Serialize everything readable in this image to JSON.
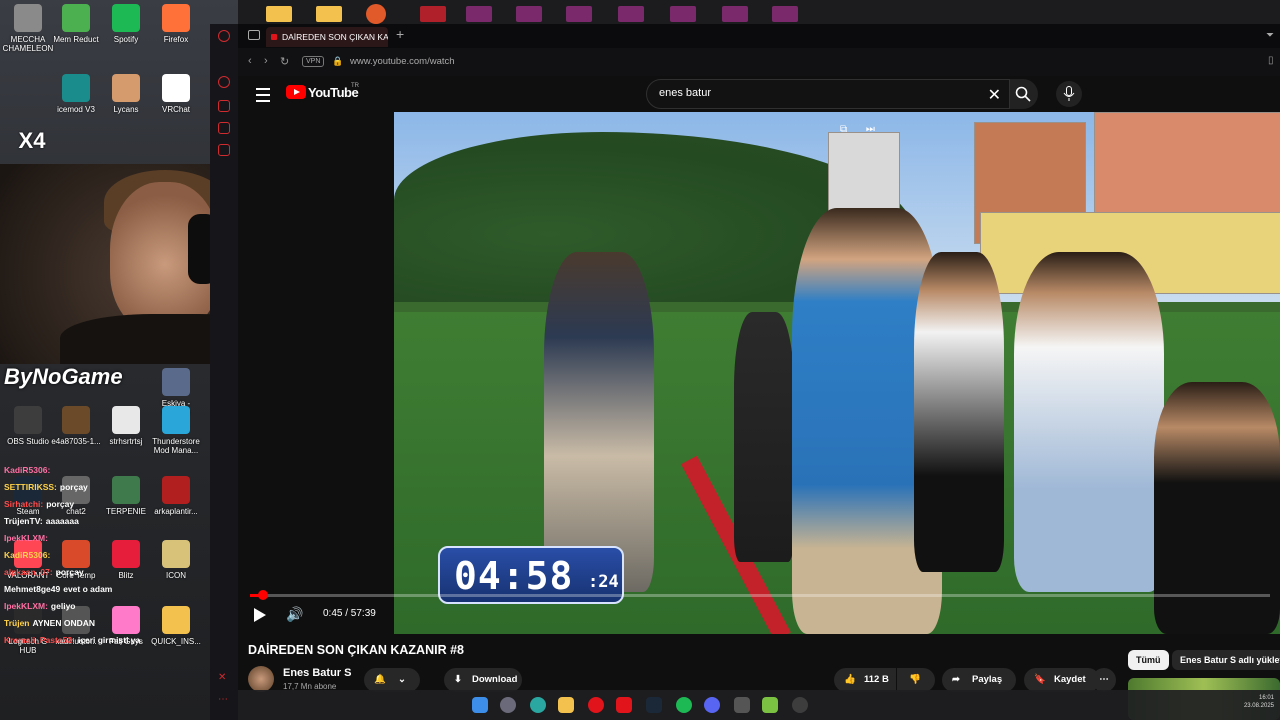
{
  "desktop": {
    "icons": [
      {
        "label": "MECCHA CHAMELEON",
        "color": "#8a8a8a"
      },
      {
        "label": "Mem Reduct",
        "color": "#4caf50"
      },
      {
        "label": "Spotify",
        "color": "#1db954"
      },
      {
        "label": "Firefox",
        "color": "#ff7139"
      },
      {
        "label": "icemod V3",
        "color": "#1b8c8c"
      },
      {
        "label": "Lycans",
        "color": "#d59b6d"
      },
      {
        "label": "VRChat",
        "color": "#ffffff"
      },
      {
        "label": "Eskiya - Chrome",
        "color": "#5a6a8a"
      },
      {
        "label": "OBS Studio",
        "color": "#3d3d3d"
      },
      {
        "label": "e4a87035-1...",
        "color": "#6b4a2a"
      },
      {
        "label": "strhsrtrtsj",
        "color": "#e8e8e8"
      },
      {
        "label": "Thunderstore Mod Mana...",
        "color": "#2aa7d8"
      },
      {
        "label": "Steam",
        "color": "#1b2838"
      },
      {
        "label": "chat2",
        "color": "#666666"
      },
      {
        "label": "TERPENIE",
        "color": "#3e7a4b"
      },
      {
        "label": "arkaplantir...",
        "color": "#b21f1f"
      },
      {
        "label": "VALORANT",
        "color": "#ff4655"
      },
      {
        "label": "Core Temp",
        "color": "#d84a2a"
      },
      {
        "label": "Blitz",
        "color": "#e61e3c"
      },
      {
        "label": "ICON",
        "color": "#d8c27a"
      },
      {
        "label": "Logitech G HUB",
        "color": "#2a2a2a"
      },
      {
        "label": "kadirluoto...",
        "color": "#555555"
      },
      {
        "label": "Fall Guys",
        "color": "#ff7ac8"
      },
      {
        "label": "QUICK_INS...",
        "color": "#f2c14e"
      }
    ],
    "overlay_badge": "X4",
    "streamer_logo": "ByNoGame"
  },
  "chat": [
    {
      "user": "KadiR5306:",
      "msg": ""
    },
    {
      "user": "SETTIRIKSS:",
      "msg": "porçay"
    },
    {
      "user": "Sirhatchi:",
      "msg": "porçay"
    },
    {
      "user": "TrüjenTV:",
      "msg": "aaaaaaa"
    },
    {
      "user": "IpekKLXM:",
      "msg": ""
    },
    {
      "user": "KadiR5306:",
      "msg": ""
    },
    {
      "user": "alpkaan_07:",
      "msg": "porçay"
    },
    {
      "user": "Mehmet8ge49",
      "msg": "evet o adam"
    },
    {
      "user": "IpekKLXM:",
      "msg": "geliyo"
    },
    {
      "user": "Trüjen",
      "msg": "AYNEN ONDAN"
    },
    {
      "user": "Kremali_Pasta53:",
      "msg": "içeri girmişti ya"
    }
  ],
  "browser": {
    "tab_title": "DAİREDEN SON ÇIKAN KAZ",
    "new_tab": "+",
    "vpn": "VPN",
    "url": "www.youtube.com/watch"
  },
  "youtube": {
    "logo_text": "YouTube",
    "logo_sup": "TR",
    "search_value": "enes batur",
    "video": {
      "timer_main": "04:58",
      "timer_sub": ":24",
      "current_time": "0:45",
      "duration": "57:39",
      "time_display": "0:45 / 57:39",
      "progress_fraction": 0.013
    },
    "title": "DAİREDEN SON ÇIKAN KAZANIR #8",
    "channel": {
      "name": "Enes Batur S",
      "subscribers": "17,7 Mn abone"
    },
    "actions": {
      "download": "Download",
      "likes": "112 B",
      "share": "Paylaş",
      "save": "Kaydet",
      "more": "⋯"
    },
    "chips": {
      "all": "Tümü",
      "channel": "Enes Batur S adlı yükleyi"
    }
  },
  "taskbar": {
    "date": "23.08.2025",
    "time": "16:01"
  }
}
